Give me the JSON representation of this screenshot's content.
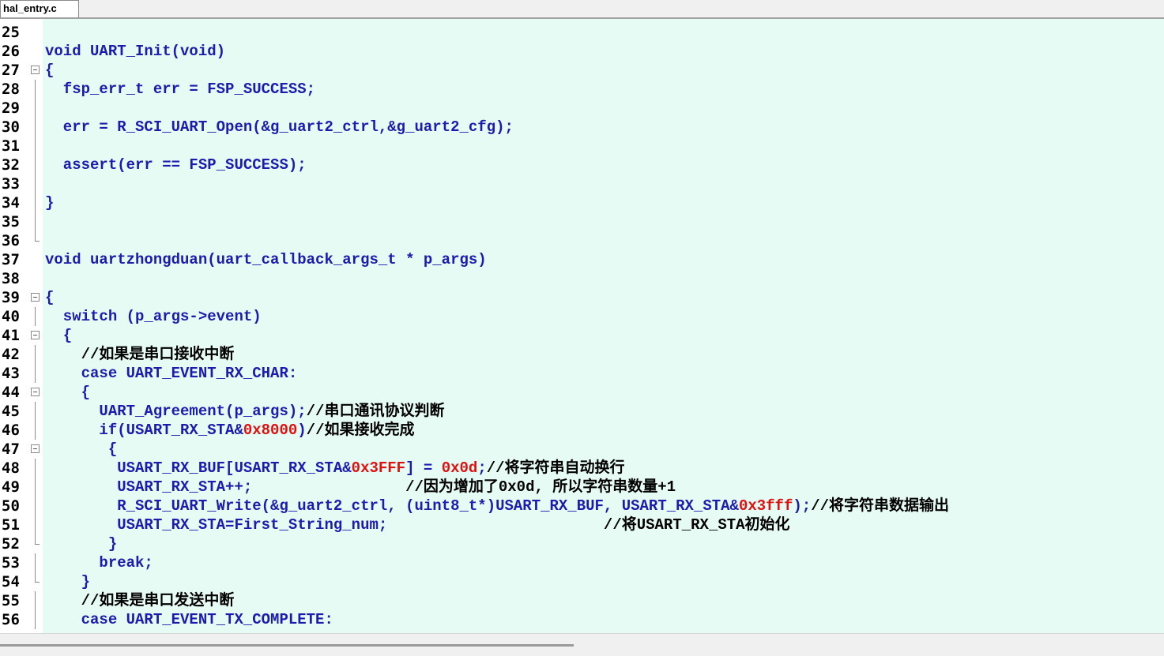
{
  "tab": {
    "label": "hal_entry.c"
  },
  "code_lines": [
    {
      "n": "25",
      "fold": "none",
      "text": ""
    },
    {
      "n": "26",
      "fold": "none",
      "text": "void UART_Init(void)"
    },
    {
      "n": "27",
      "fold": "box",
      "text": "{"
    },
    {
      "n": "28",
      "fold": "bar",
      "text": "  fsp_err_t err = FSP_SUCCESS;"
    },
    {
      "n": "29",
      "fold": "bar",
      "text": ""
    },
    {
      "n": "30",
      "fold": "bar",
      "text": "  err = R_SCI_UART_Open(&g_uart2_ctrl,&g_uart2_cfg);"
    },
    {
      "n": "31",
      "fold": "bar",
      "text": ""
    },
    {
      "n": "32",
      "fold": "bar",
      "text": "  assert(err == FSP_SUCCESS);"
    },
    {
      "n": "33",
      "fold": "bar",
      "text": ""
    },
    {
      "n": "34",
      "fold": "bar",
      "text": "}"
    },
    {
      "n": "35",
      "fold": "bar",
      "text": ""
    },
    {
      "n": "36",
      "fold": "end",
      "text": ""
    },
    {
      "n": "37",
      "fold": "none",
      "text": "void uartzhongduan(uart_callback_args_t * p_args)"
    },
    {
      "n": "38",
      "fold": "none",
      "text": ""
    },
    {
      "n": "39",
      "fold": "box",
      "text": "{"
    },
    {
      "n": "40",
      "fold": "bar",
      "text": "  switch (p_args->event)"
    },
    {
      "n": "41",
      "fold": "box",
      "text": "  {"
    },
    {
      "n": "42",
      "fold": "bar",
      "text": "    //如果是串口接收中断"
    },
    {
      "n": "43",
      "fold": "bar",
      "text": "    case UART_EVENT_RX_CHAR:"
    },
    {
      "n": "44",
      "fold": "box",
      "text": "    {"
    },
    {
      "n": "45",
      "fold": "bar",
      "text": "      UART_Agreement(p_args);//串口通讯协议判断"
    },
    {
      "n": "46",
      "fold": "bar",
      "text": "      if(USART_RX_STA&0x8000)//如果接收完成"
    },
    {
      "n": "47",
      "fold": "box",
      "text": "       {"
    },
    {
      "n": "48",
      "fold": "bar",
      "text": "        USART_RX_BUF[USART_RX_STA&0x3FFF] = 0x0d;//将字符串自动换行"
    },
    {
      "n": "49",
      "fold": "bar",
      "text": "        USART_RX_STA++;                 //因为增加了0x0d, 所以字符串数量+1"
    },
    {
      "n": "50",
      "fold": "bar",
      "text": "        R_SCI_UART_Write(&g_uart2_ctrl, (uint8_t*)USART_RX_BUF, USART_RX_STA&0x3fff);//将字符串数据输出"
    },
    {
      "n": "51",
      "fold": "bar",
      "text": "        USART_RX_STA=First_String_num;                        //将USART_RX_STA初始化"
    },
    {
      "n": "52",
      "fold": "end",
      "text": "       }"
    },
    {
      "n": "53",
      "fold": "bar",
      "text": "      break;"
    },
    {
      "n": "54",
      "fold": "end",
      "text": "    }"
    },
    {
      "n": "55",
      "fold": "bar",
      "text": "    //如果是串口发送中断"
    },
    {
      "n": "56",
      "fold": "bar",
      "text": "    case UART_EVENT_TX_COMPLETE:"
    }
  ],
  "colors": {
    "editor_bg": "#e6fbf4",
    "code": "#1b1bb0",
    "hex_literal": "#e01010",
    "comment": "#000000"
  }
}
